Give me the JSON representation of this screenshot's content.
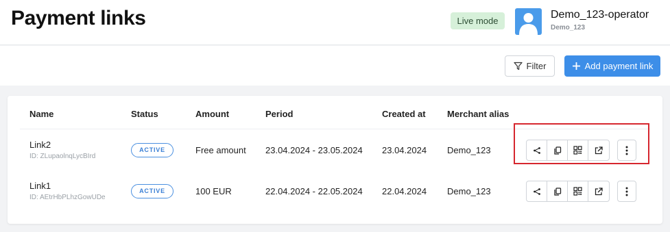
{
  "header": {
    "title": "Payment links",
    "mode_badge": "Live mode",
    "user_name": "Demo_123-operator",
    "user_org": "Demo_123"
  },
  "toolbar": {
    "filter_label": "Filter",
    "add_label": "Add payment link"
  },
  "table": {
    "columns": [
      "Name",
      "Status",
      "Amount",
      "Period",
      "Created at",
      "Merchant alias"
    ],
    "rows": [
      {
        "name": "Link2",
        "id": "ID: ZLupaolnqLycBIrd",
        "status": "ACTIVE",
        "amount": "Free amount",
        "period": "23.04.2024 - 23.05.2024",
        "created_at": "23.04.2024",
        "merchant_alias": "Demo_123"
      },
      {
        "name": "Link1",
        "id": "ID: AEtrHbPLhzGowUDe",
        "status": "ACTIVE",
        "amount": "100 EUR",
        "period": "22.04.2024 - 22.05.2024",
        "created_at": "22.04.2024",
        "merchant_alias": "Demo_123"
      }
    ]
  },
  "colors": {
    "accent": "#3d8ee8",
    "live_badge_bg": "#d6f0d9",
    "status_blue": "#3a7fd5",
    "highlight": "#d6262e"
  },
  "icons": {
    "row_actions": [
      "share-icon",
      "copy-icon",
      "qr-code-icon",
      "external-link-icon"
    ],
    "more": "more-vertical-icon",
    "filter": "filter-icon",
    "add": "plus-icon",
    "avatar": "user-icon"
  }
}
